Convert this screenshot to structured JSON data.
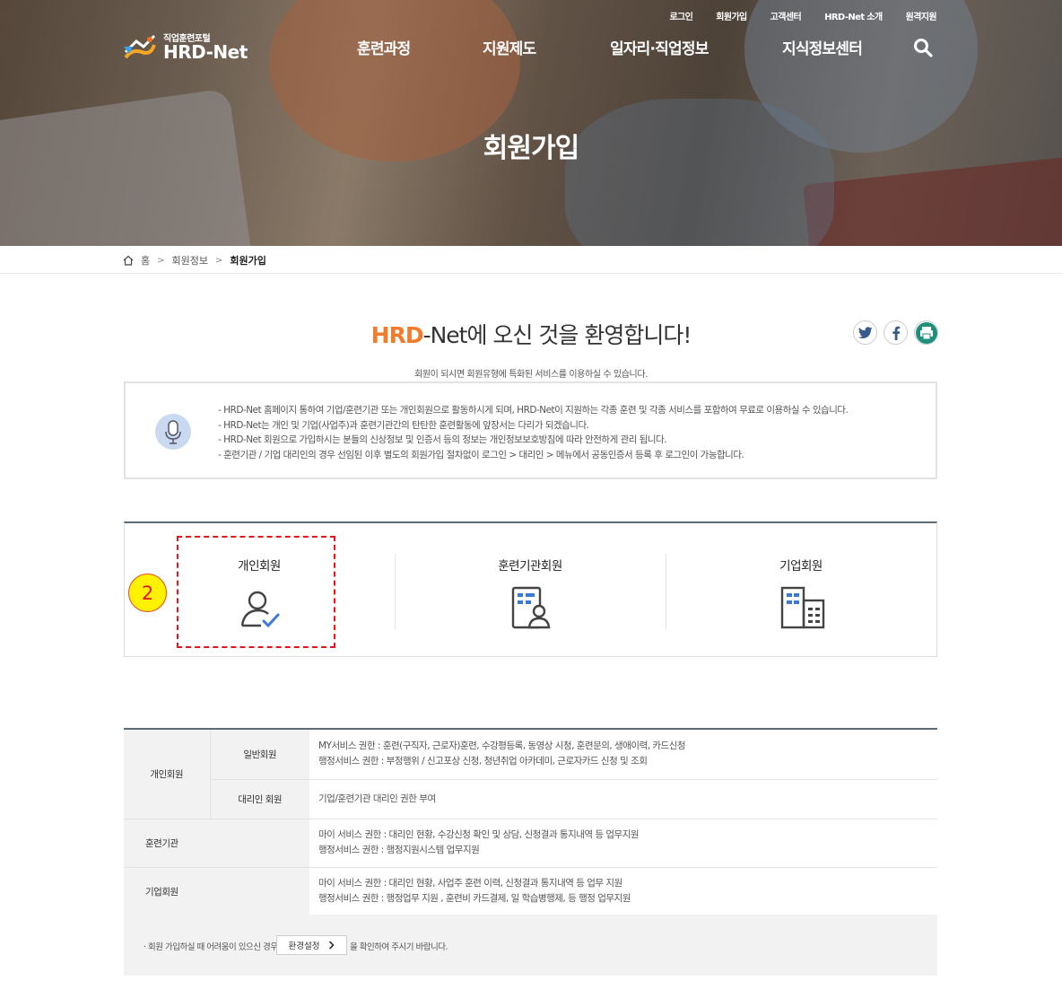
{
  "header": {
    "logo_subtitle": "직업훈련포털",
    "logo_title": "HRD-Net",
    "utility_links": [
      "로그인",
      "회원가입",
      "고객센터",
      "HRD-Net 소개",
      "원격지원"
    ],
    "main_nav": [
      "훈련과정",
      "지원제도",
      "일자리·직업정보",
      "지식정보센터"
    ],
    "page_title": "회원가입"
  },
  "breadcrumb": {
    "home": "홈",
    "parent": "회원정보",
    "current": "회원가입"
  },
  "welcome": {
    "brand": "HRD",
    "rest": "-Net에 오신 것을 환영합니다!",
    "intro": "회원이 되시면 회원유형에 특화된 서비스를 이용하실 수 있습니다."
  },
  "share": [
    "twitter-icon",
    "facebook-icon",
    "print-icon"
  ],
  "notice": {
    "lines": [
      "- HRD-Net 홈페이지 통하여 기업/훈련기관 또는 개인회원으로 활동하시게 되며, HRD-Net이 지원하는 각종 훈련 및 각종 서비스를 포함하여 무료로 이용하실 수 있습니다.",
      "- HRD-Net는 개인 및 기업(사업주)과 훈련기관간의 탄탄한 훈련활동에 앞장서는 다리가 되겠습니다.",
      "- HRD-Net 회원으로 가입하시는 분들의 신상정보 및 인증서 등의 정보는 개인정보보호방침에 따라 안전하게 관리 됩니다.",
      "- 훈련기관 / 기업 대리인의 경우 선임된 이후 별도의 회원가입 절차없이 로그인 > 대리인 > 메뉴에서 공동인증서 등록 후 로그인이 가능합니다."
    ]
  },
  "member_types": [
    {
      "label": "개인회원",
      "icon": "person-check-icon"
    },
    {
      "label": "훈련기관회원",
      "icon": "institution-person-icon"
    },
    {
      "label": "기업회원",
      "icon": "building-icon"
    }
  ],
  "annotation": {
    "step": "2"
  },
  "info_table": {
    "personal": {
      "group": "개인회원",
      "general": {
        "label": "일반회원",
        "lines": [
          "MY서비스 권한 : 훈련(구직자, 근로자)훈련, 수강평등록, 동영상 시청, 훈련문의, 생애이력, 카드신청",
          "행정서비스 권한 : 부정행위 / 신고포상 신청, 청년취업 아카데미, 근로자카드 신청 및 조회"
        ]
      },
      "agent": {
        "label": "대리인 회원",
        "lines": [
          "기업/훈련기관 대리인 권한 부여"
        ]
      }
    },
    "institution": {
      "group": "훈련기관",
      "lines": [
        "마이 서비스 권한 : 대리인 현황, 수강신청 확인 및 상담, 신청결과 통지내역 등 업무지원",
        "행정서비스 권한 : 행정지원시스템 업무지원"
      ]
    },
    "company": {
      "group": "기업회원",
      "lines": [
        "마이 서비스 권한 : 대리인 현황, 사업주 훈련 이력, 신청결과 통지내역 등 업무 지원",
        "행정서비스 권한 : 행정업무 지원 , 훈련비 카드결제, 일 학습병행제, 등 행정 업무지원"
      ]
    }
  },
  "footer_note": {
    "before": "· 회원 가입하실 때 어려움이 있으신 경우",
    "button": "환경설정",
    "after": "을 확인하여 주시기 바랍니다."
  },
  "colors": {
    "brand_orange": "#f07c2c",
    "icon_blue": "#3b79d8",
    "table_border": "#5f6a79",
    "highlight_red": "#e3161b",
    "badge_yellow": "#fff200"
  }
}
